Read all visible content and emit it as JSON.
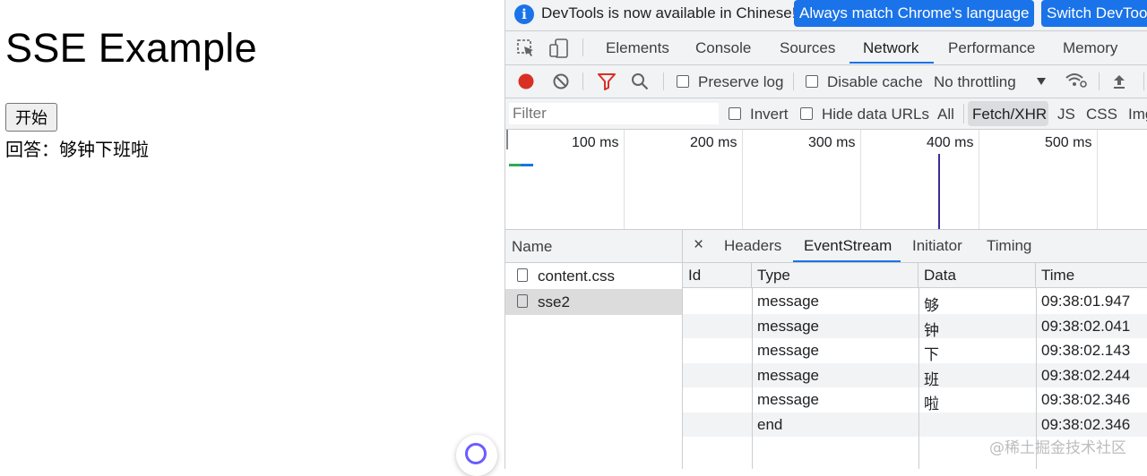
{
  "page": {
    "heading": "SSE Example",
    "start_button": "开始",
    "answer": "回答：够钟下班啦"
  },
  "devtools": {
    "infobar": {
      "icon": "i",
      "message": "DevTools is now available in Chinese!",
      "match_button": "Always match Chrome's language",
      "switch_button": "Switch DevTools"
    },
    "tabs": [
      "Elements",
      "Console",
      "Sources",
      "Network",
      "Performance",
      "Memory"
    ],
    "active_tab": "Network",
    "toolbar": {
      "preserve_log": "Preserve log",
      "disable_cache": "Disable cache",
      "throttling": "No throttling"
    },
    "filterbar": {
      "placeholder": "Filter",
      "invert": "Invert",
      "hide_data_urls": "Hide data URLs",
      "types": [
        "All",
        "Fetch/XHR",
        "JS",
        "CSS",
        "Img"
      ],
      "active_type": "Fetch/XHR"
    },
    "timeline": {
      "ticks": [
        "100 ms",
        "200 ms",
        "300 ms",
        "400 ms",
        "500 ms"
      ]
    },
    "requests": {
      "header": "Name",
      "items": [
        "content.css",
        "sse2"
      ],
      "selected": "sse2"
    },
    "detail_tabs": {
      "close": "×",
      "items": [
        "Headers",
        "EventStream",
        "Initiator",
        "Timing"
      ],
      "active": "EventStream"
    },
    "eventstream": {
      "columns": [
        "Id",
        "Type",
        "Data",
        "Time"
      ],
      "rows": [
        {
          "id": "",
          "type": "message",
          "data": "够",
          "time": "09:38:01.947"
        },
        {
          "id": "",
          "type": "message",
          "data": "钟",
          "time": "09:38:02.041"
        },
        {
          "id": "",
          "type": "message",
          "data": "下",
          "time": "09:38:02.143"
        },
        {
          "id": "",
          "type": "message",
          "data": "班",
          "time": "09:38:02.244"
        },
        {
          "id": "",
          "type": "message",
          "data": "啦",
          "time": "09:38:02.346"
        },
        {
          "id": "",
          "type": "end",
          "data": "",
          "time": "09:38:02.346"
        }
      ]
    }
  },
  "watermark": "@稀土掘金技术社区",
  "colors": {
    "accent": "#1a73e8",
    "record": "#d93025",
    "filter_icon": "#d93025"
  }
}
